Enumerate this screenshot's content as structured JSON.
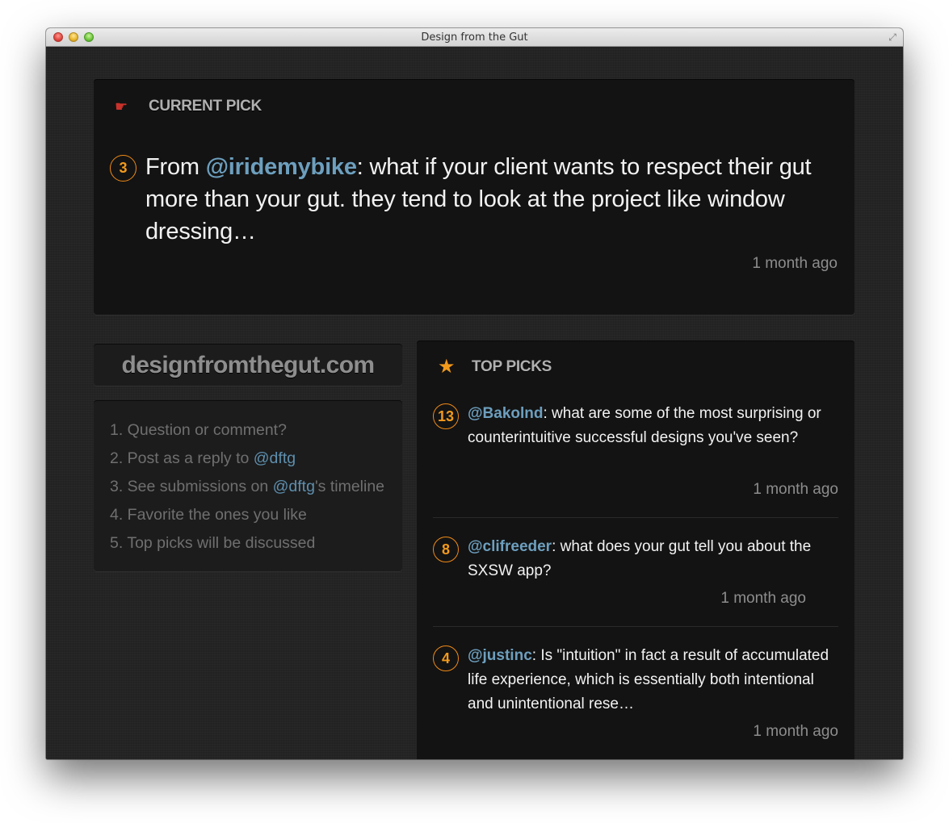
{
  "window": {
    "title": "Design from the Gut"
  },
  "current_pick": {
    "heading": "CURRENT PICK",
    "votes": "3",
    "prefix": "From ",
    "user": "@iridemybike",
    "body": ": what if your client wants to respect their gut more than your gut. they tend to look at the project like window dressing…",
    "time": "1 month ago"
  },
  "site": {
    "name": "designfromthegut.com"
  },
  "steps": [
    {
      "text": "1. Question or comment?"
    },
    {
      "pre": "2. Post as a reply to ",
      "mention": "@dftg",
      "post": ""
    },
    {
      "pre": "3. See submissions on ",
      "mention": "@dftg",
      "post": "'s timeline"
    },
    {
      "text": "4. Favorite the ones you like"
    },
    {
      "text": "5. Top picks will be discussed"
    }
  ],
  "top_picks": {
    "heading": "TOP PICKS",
    "items": [
      {
        "votes": "13",
        "user": "@Bakolnd",
        "body": ": what are some of the most surprising or counterintuitive successful designs you've seen?",
        "time": "1 month ago"
      },
      {
        "votes": "8",
        "user": "@clifreeder",
        "body": ": what does your gut tell you about the SXSW app?",
        "time": "1 month ago"
      },
      {
        "votes": "4",
        "user": "@justinc",
        "body": ": Is \"intuition\" in fact a result of accumulated life experience, which is essentially both intentional and unintentional rese…",
        "time": "1 month ago"
      }
    ]
  },
  "colors": {
    "accent": "#f29a1c",
    "mention": "#6d9fbe",
    "hand": "#c8322b"
  }
}
